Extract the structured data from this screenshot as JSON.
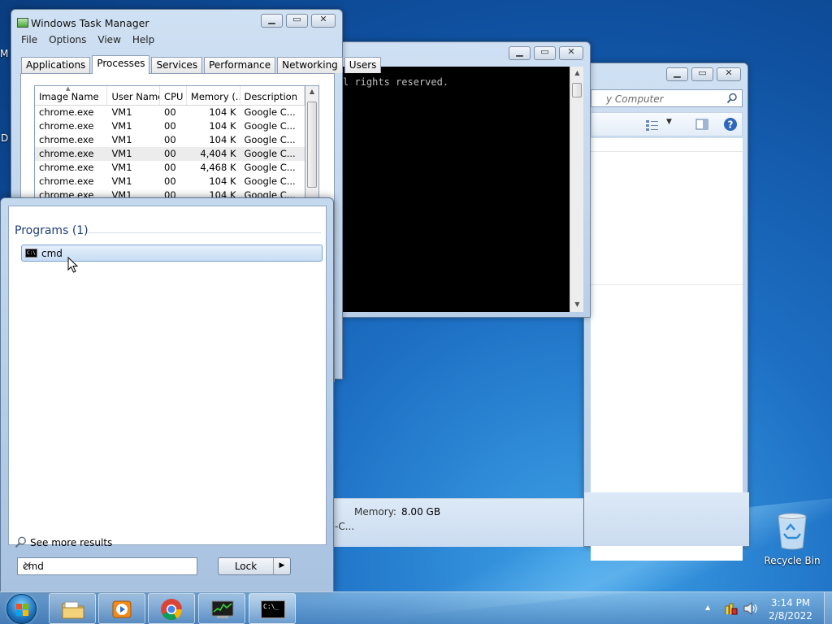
{
  "colors": {
    "accent": "#1e3e7a",
    "selection": "#c7dcf4",
    "console_bg": "#000000"
  },
  "desktop": {
    "edge_letter_top": "M",
    "edge_letter_bottom": "D",
    "recycle_bin_label": "Recycle Bin"
  },
  "explorer": {
    "address_text": "y Computer",
    "details_memory_label": "Memory:",
    "details_memory_value": "8.00 GB",
    "details_cpu_fragment": "-C..."
  },
  "cmd": {
    "console_text": "l rights reserved."
  },
  "task_manager": {
    "title": "Windows Task Manager",
    "menu": [
      "File",
      "Options",
      "View",
      "Help"
    ],
    "tabs": [
      "Applications",
      "Processes",
      "Services",
      "Performance",
      "Networking",
      "Users"
    ],
    "active_tab": "Processes",
    "columns": [
      "Image Name",
      "User Name",
      "CPU",
      "Memory (...",
      "Description"
    ],
    "rows": [
      {
        "image": "chrome.exe",
        "user": "VM1",
        "cpu": "00",
        "memory": "104 K",
        "desc": "Google C..."
      },
      {
        "image": "chrome.exe",
        "user": "VM1",
        "cpu": "00",
        "memory": "104 K",
        "desc": "Google C..."
      },
      {
        "image": "chrome.exe",
        "user": "VM1",
        "cpu": "00",
        "memory": "104 K",
        "desc": "Google C..."
      },
      {
        "image": "chrome.exe",
        "user": "VM1",
        "cpu": "00",
        "memory": "4,404 K",
        "desc": "Google C..."
      },
      {
        "image": "chrome.exe",
        "user": "VM1",
        "cpu": "00",
        "memory": "4,468 K",
        "desc": "Google C..."
      },
      {
        "image": "chrome.exe",
        "user": "VM1",
        "cpu": "00",
        "memory": "104 K",
        "desc": "Google C..."
      },
      {
        "image": "chrome.exe",
        "user": "VM1",
        "cpu": "00",
        "memory": "104 K",
        "desc": "Google C..."
      }
    ],
    "selected_row": 3
  },
  "start_menu": {
    "group_title": "Programs (1)",
    "result_label": "cmd",
    "result_icon_text": "C:\\",
    "see_more": "See more results",
    "search_value": "cmd",
    "clear_glyph": "×",
    "lock_label": "Lock",
    "arrow_glyph": "▶"
  },
  "taskbar": {
    "pinned": [
      "windows-explorer",
      "media-player",
      "chrome",
      "task-manager",
      "command-prompt"
    ],
    "cmd_icon_text": "C:\\_",
    "clock_time": "3:14 PM",
    "clock_date": "2/8/2022"
  }
}
